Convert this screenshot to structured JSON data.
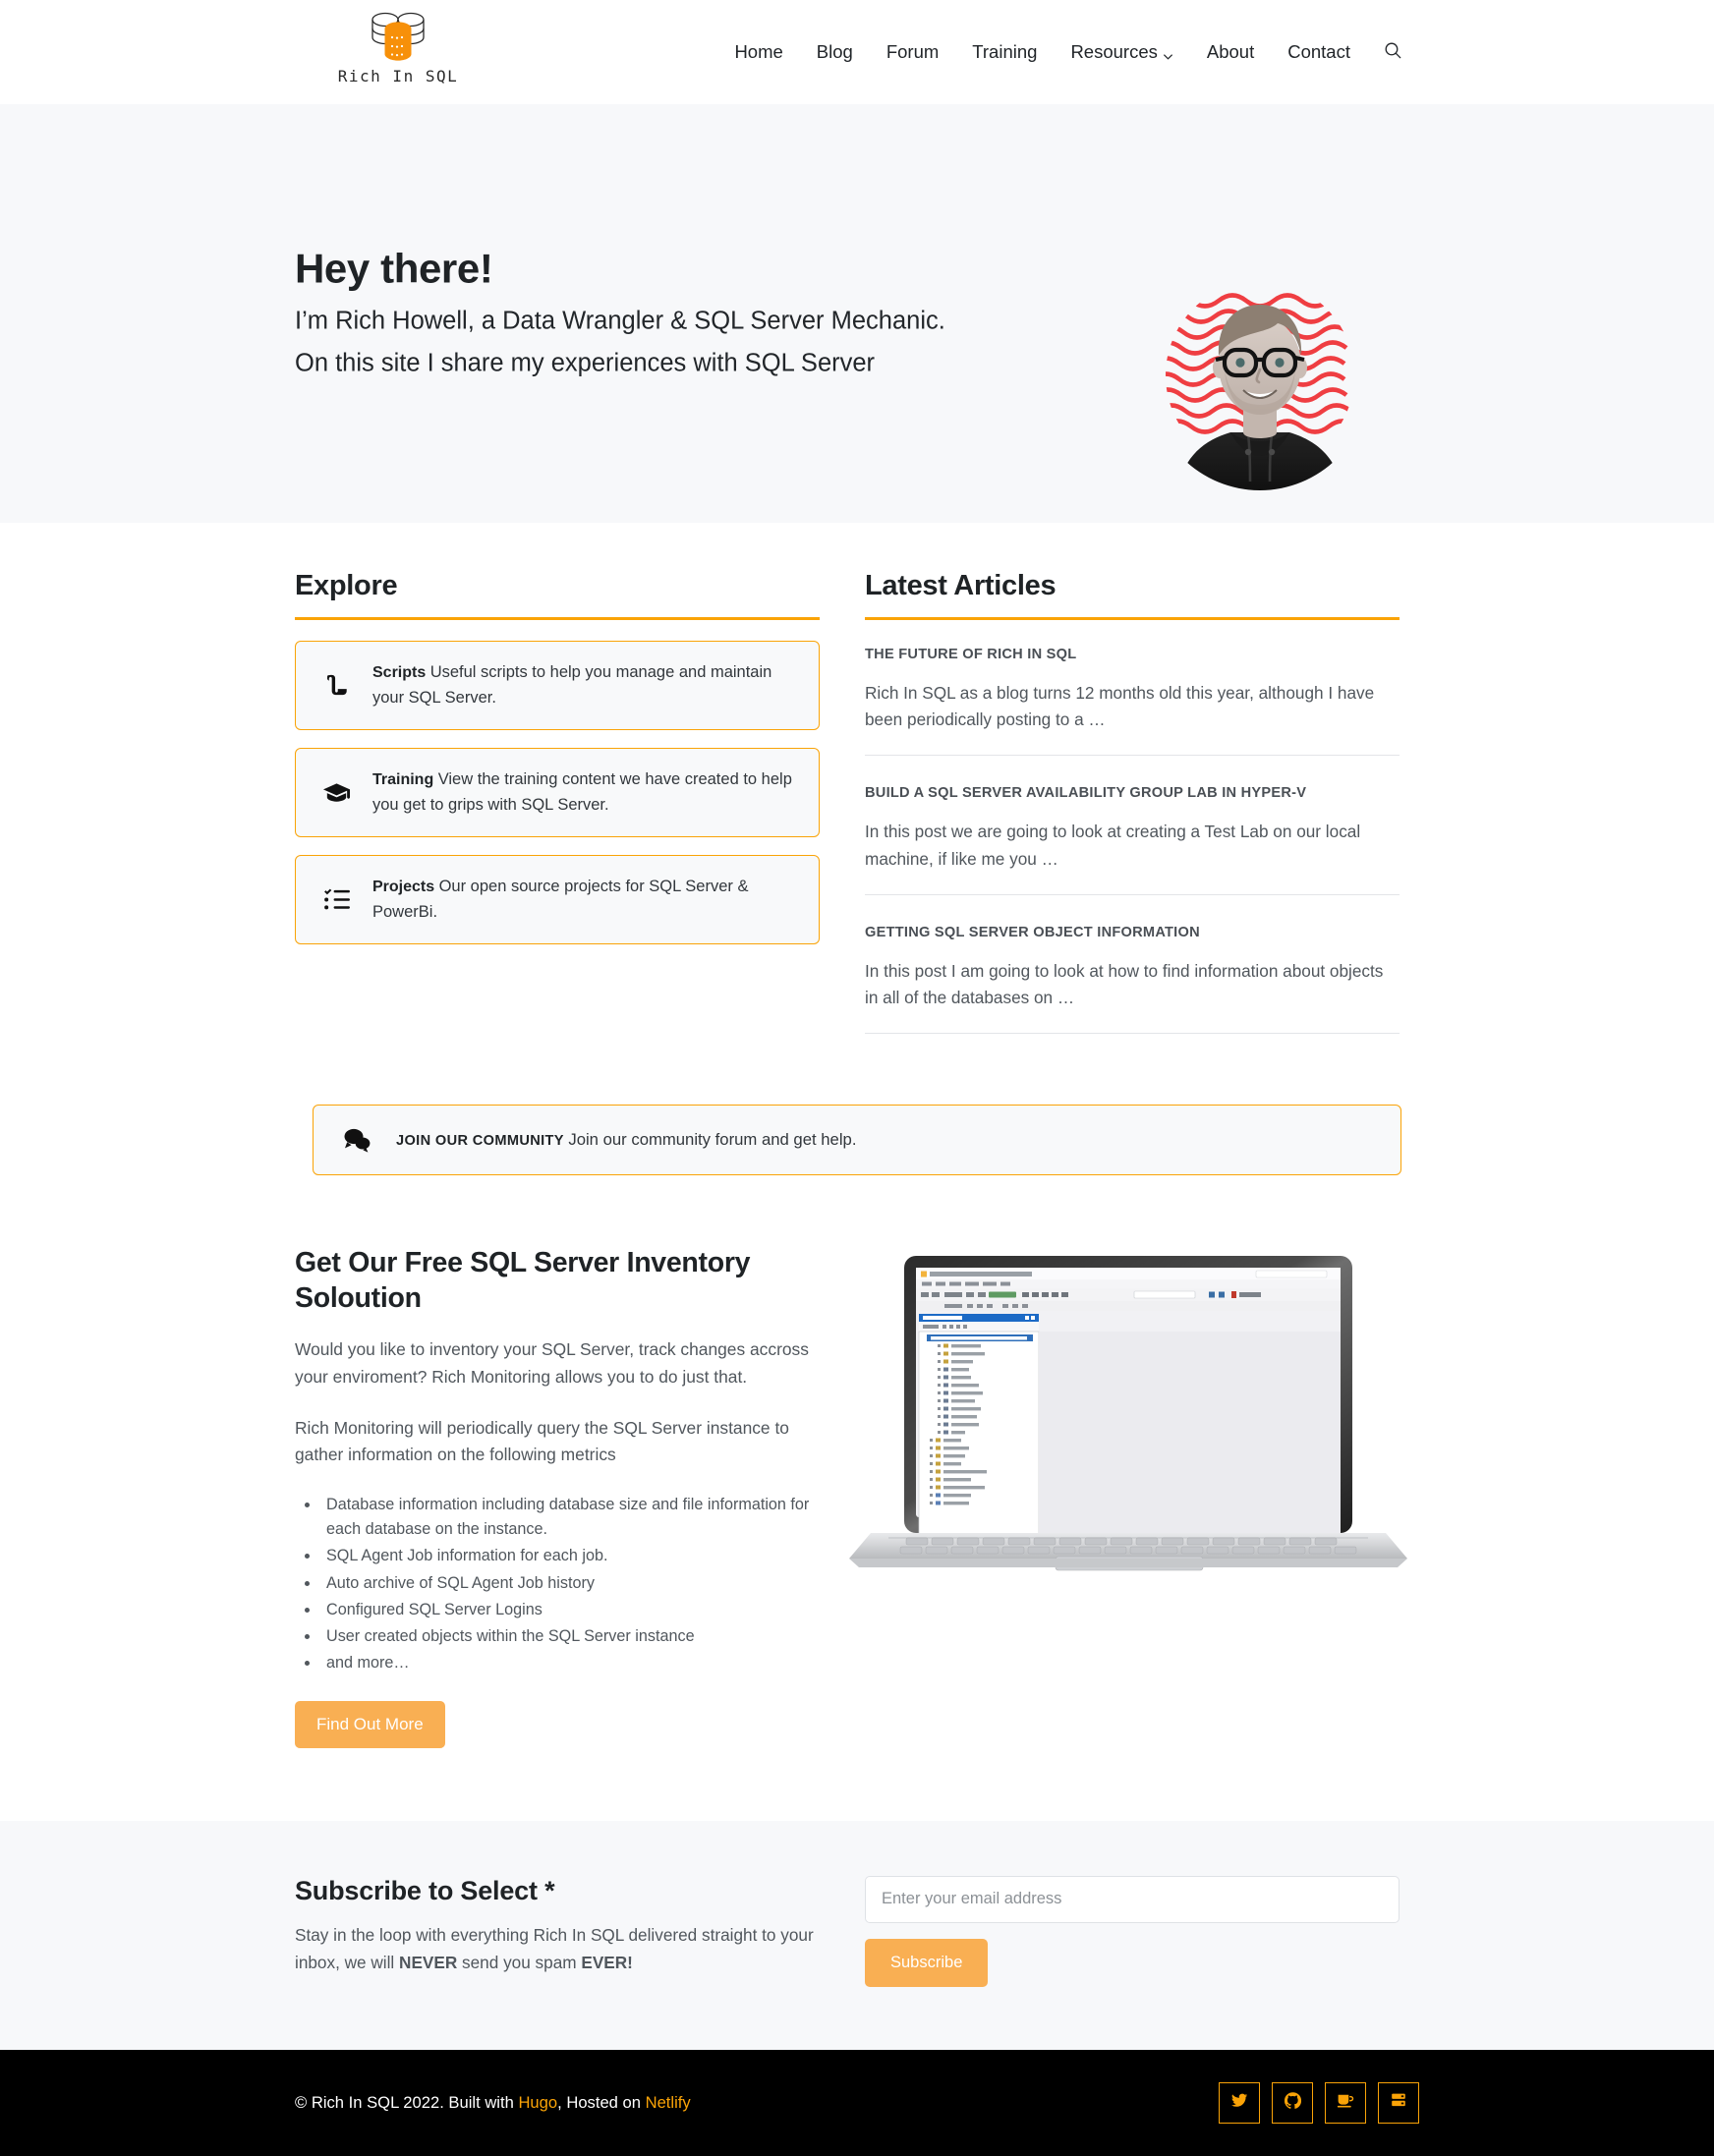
{
  "header": {
    "brand": {
      "text": "Rich In SQL",
      "logo_icon": "database-stack-icon"
    },
    "nav": [
      {
        "label": "Home",
        "icon": null
      },
      {
        "label": "Blog",
        "icon": null
      },
      {
        "label": "Forum",
        "icon": null
      },
      {
        "label": "Training",
        "icon": null
      },
      {
        "label": "Resources",
        "icon": "chevron-down-icon"
      },
      {
        "label": "About",
        "icon": null
      },
      {
        "label": "Contact",
        "icon": null
      }
    ],
    "search_icon": "search-icon"
  },
  "hero": {
    "title": "Hey there!",
    "subtitle": "I’m Rich Howell, a Data Wrangler & SQL Server Mechanic.",
    "tagline": "On this site I share my experiences with SQL Server",
    "photo_alt": "portrait-photo"
  },
  "explore": {
    "heading": "Explore",
    "cards": [
      {
        "icon": "scroll-icon",
        "title": "Scripts",
        "desc": "Useful scripts to help you manage and maintain your SQL Server."
      },
      {
        "icon": "graduation-cap-icon",
        "title": "Training",
        "desc": "View the training content we have created to help you get to grips with SQL Server."
      },
      {
        "icon": "checklist-icon",
        "title": "Projects",
        "desc": "Our open source projects for SQL Server & PowerBi."
      }
    ]
  },
  "latest_articles": {
    "heading": "Latest Articles",
    "articles": [
      {
        "title": "THE FUTURE OF RICH IN SQL",
        "excerpt": "Rich In SQL as a blog turns 12 months old this year, although I have been periodically posting to a …"
      },
      {
        "title": "BUILD A SQL SERVER AVAILABILITY GROUP LAB IN HYPER-V",
        "excerpt": "In this post we are going to look at creating a Test Lab on our local machine, if like me you …"
      },
      {
        "title": "GETTING SQL SERVER OBJECT INFORMATION",
        "excerpt": "In this post I am going to look at how to find information about objects in all of the databases on …"
      }
    ]
  },
  "community": {
    "icon": "chat-bubbles-icon",
    "title": "JOIN OUR COMMUNITY",
    "desc": "Join our community forum and get help."
  },
  "promo": {
    "heading": "Get Our Free SQL Server Inventory Soloution",
    "paragraph1": "Would you like to inventory your SQL Server, track changes accross your enviroment? Rich Monitoring allows you to do just that.",
    "paragraph2": "Rich Monitoring will periodically query the SQL Server instance to gather information on the following metrics",
    "bullets": [
      "Database information including database size and file information for each database on the instance.",
      "SQL Agent Job information for each job.",
      "Auto archive of SQL Agent Job history",
      "Configured SQL Server Logins",
      "User created objects within the SQL Server instance",
      "and more…"
    ],
    "cta_label": "Find Out More",
    "image_alt": "laptop-ssms-screenshot"
  },
  "subscribe": {
    "heading": "Subscribe to Select *",
    "text_before": "Stay in the loop with everything Rich In SQL delivered straight to your inbox, we will ",
    "strong1": "NEVER",
    "text_middle": " send you spam ",
    "strong2": "EVER!",
    "placeholder": "Enter your email address",
    "input_value": "",
    "button_label": "Subscribe"
  },
  "footer": {
    "copy_prefix": "© Rich In SQL 2022. Built with ",
    "hugo_label": "Hugo",
    "copy_middle": ", Hosted on ",
    "netlify_label": "Netlify",
    "socials": [
      {
        "icon": "twitter-icon",
        "name": "twitter"
      },
      {
        "icon": "github-icon",
        "name": "github"
      },
      {
        "icon": "coffee-cup-icon",
        "name": "buy-me-a-coffee"
      },
      {
        "icon": "database-icon",
        "name": "database"
      }
    ]
  },
  "colors": {
    "accent_border": "#FAA307",
    "accent_button": "#F9AF53",
    "band_bg": "#F7F8FA",
    "footer_bg": "#000000",
    "text": "#212529"
  }
}
